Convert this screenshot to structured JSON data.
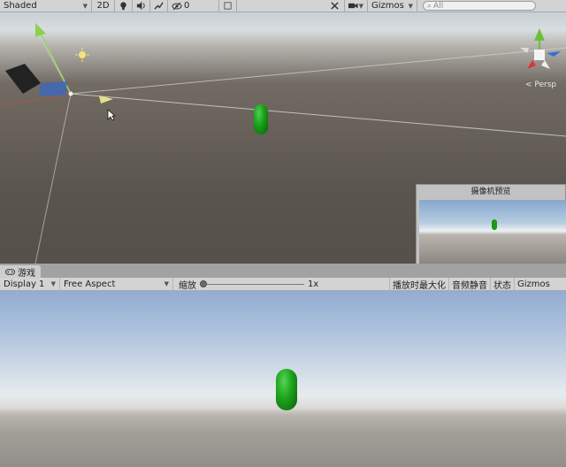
{
  "scene_toolbar": {
    "shading_mode": "Shaded",
    "mode_2d": "2D",
    "hidden_count": "0",
    "gizmos_label": "Gizmos",
    "search_placeholder": "All",
    "icons": [
      "light-bulb-icon",
      "audio-icon",
      "effects-icon",
      "eye-hidden-icon",
      "layers-icon",
      "tools-icon",
      "camera-icon"
    ]
  },
  "scene_view": {
    "projection_label": "< Persp",
    "camera_preview": {
      "title": "摄像机预览"
    }
  },
  "game_tab": {
    "label": "游戏"
  },
  "game_toolbar": {
    "display": "Display 1",
    "aspect": "Free Aspect",
    "scale_label": "缩放",
    "scale_value": "1x",
    "maximize_on_play": "播放时最大化",
    "mute_audio": "音频静音",
    "stats": "状态",
    "gizmos": "Gizmos"
  },
  "colors": {
    "toolbar_bg": "#d3d3d3",
    "capsule_green": "#1fa81f",
    "sky_blue": "#93acd2"
  }
}
